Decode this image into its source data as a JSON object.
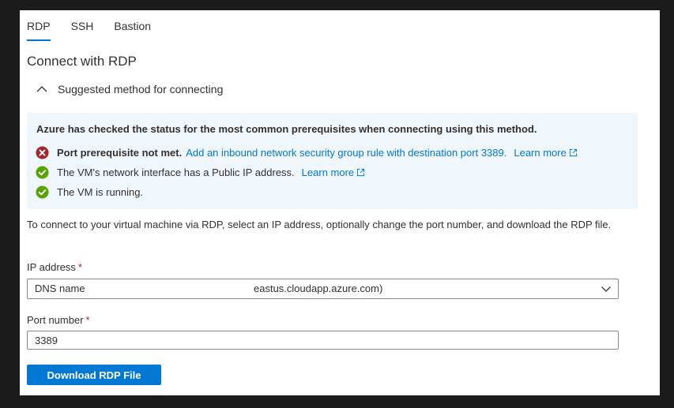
{
  "tabs": [
    {
      "label": "RDP",
      "active": true
    },
    {
      "label": "SSH",
      "active": false
    },
    {
      "label": "Bastion",
      "active": false
    }
  ],
  "title": "Connect with RDP",
  "suggested": {
    "label": "Suggested method for connecting",
    "expanded": true
  },
  "prereq": {
    "heading": "Azure has checked the status for the most common prerequisites when connecting using this method.",
    "items": [
      {
        "status": "error",
        "icon": "error-circle-icon",
        "bold": "Port prerequisite not met.",
        "text": "",
        "link": "Add an inbound network security group rule with destination port 3389.",
        "learn_more": "Learn more"
      },
      {
        "status": "success",
        "icon": "checkmark-circle-icon",
        "bold": "",
        "text": "The VM's network interface has a Public IP address.",
        "link": "",
        "learn_more": "Learn more"
      },
      {
        "status": "success",
        "icon": "checkmark-circle-icon",
        "bold": "",
        "text": "The VM is running.",
        "link": "",
        "learn_more": ""
      }
    ]
  },
  "description": "To connect to your virtual machine via RDP, select an IP address, optionally change the port number, and download the RDP file.",
  "ip_address": {
    "label": "IP address",
    "required_mark": "*",
    "selected_type": "DNS name",
    "selected_value": "eastus.cloudapp.azure.com)"
  },
  "port": {
    "label": "Port number",
    "required_mark": "*",
    "value": "3389"
  },
  "download_button": "Download RDP File",
  "colors": {
    "accent": "#0078d4",
    "error": "#a4262c",
    "success": "#57a300",
    "info_bg": "#eff6fc"
  }
}
